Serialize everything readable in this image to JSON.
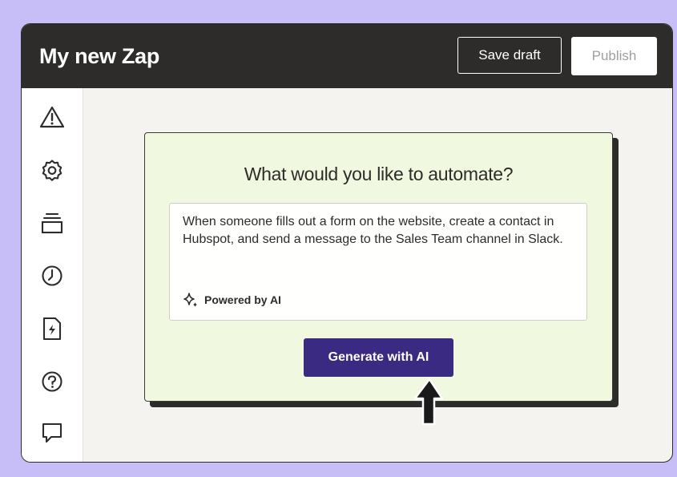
{
  "header": {
    "title": "My new Zap",
    "save_label": "Save draft",
    "publish_label": "Publish"
  },
  "sidebar": {
    "items": [
      {
        "icon": "warning-icon"
      },
      {
        "icon": "gear-icon"
      },
      {
        "icon": "versions-icon"
      },
      {
        "icon": "history-icon"
      },
      {
        "icon": "zap-file-icon"
      },
      {
        "icon": "help-icon"
      },
      {
        "icon": "feedback-icon"
      }
    ]
  },
  "main": {
    "heading": "What would you like to automate?",
    "prompt_value": "When someone fills out a form on the website, create a contact in Hubspot, and send a message to the Sales Team channel in Slack.",
    "powered_label": "Powered by AI",
    "generate_label": "Generate with AI"
  },
  "colors": {
    "background": "#c7bdf7",
    "topbar": "#2d2c2a",
    "card": "#f1f8e0",
    "accent": "#3b2a82"
  }
}
